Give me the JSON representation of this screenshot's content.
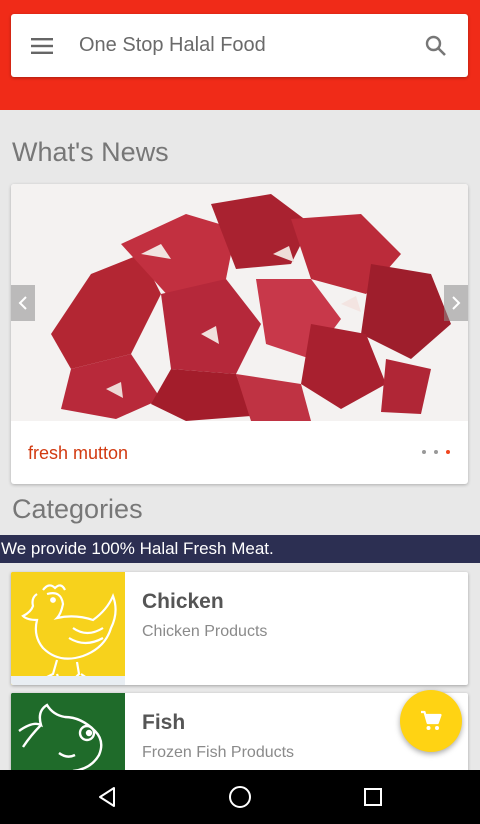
{
  "header": {
    "title": "One Stop Halal Food",
    "color": "#f02b18"
  },
  "news": {
    "section_title": "What's News",
    "caption": "fresh mutton",
    "slide_count": 3,
    "active_slide": 3
  },
  "categories": {
    "section_title": "Categories",
    "banner": "We provide 100% Halal Fresh Meat.",
    "items": [
      {
        "name": "Chicken",
        "desc": "Chicken Products",
        "thumb_color": "#f7d21c"
      },
      {
        "name": "Fish",
        "desc": "Frozen Fish Products",
        "thumb_color": "#1f6b2a"
      }
    ]
  },
  "fab": {
    "icon": "cart-icon",
    "color": "#ffd313"
  },
  "navbar": {
    "icons": [
      "back-icon",
      "home-icon",
      "recents-icon"
    ]
  }
}
